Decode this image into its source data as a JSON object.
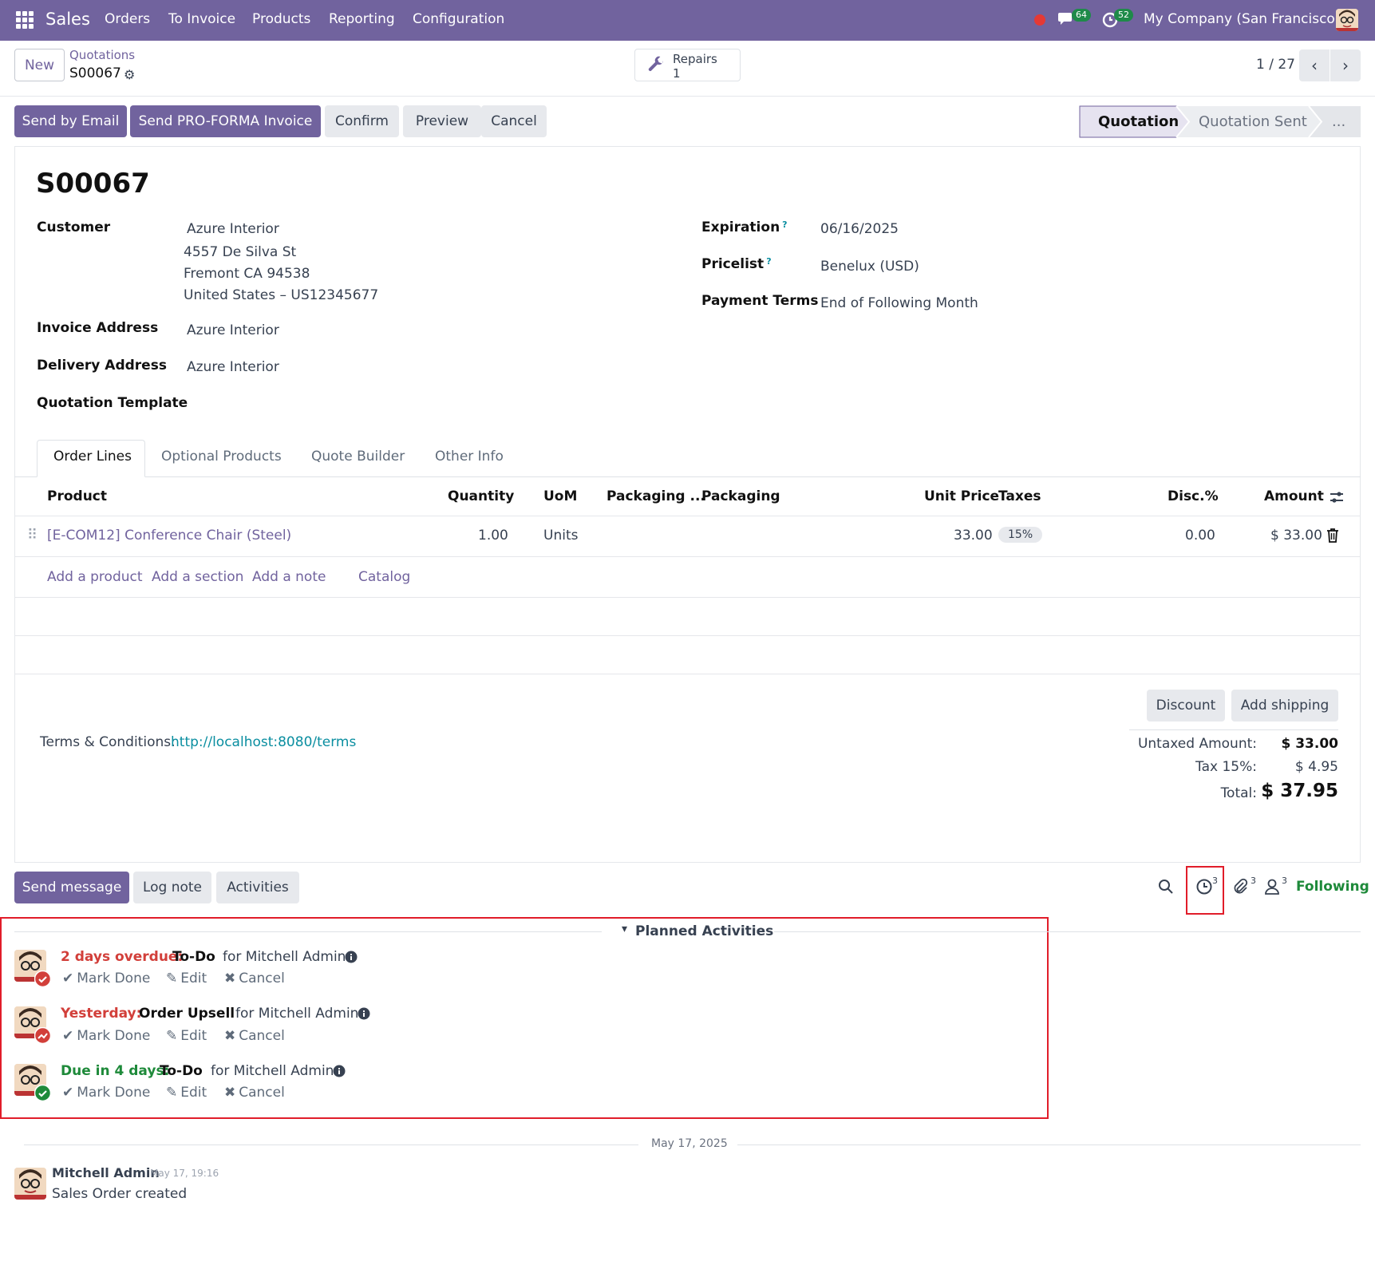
{
  "topbar": {
    "app_name": "Sales",
    "menus": [
      "Orders",
      "To Invoice",
      "Products",
      "Reporting",
      "Configuration"
    ],
    "messages_count": "64",
    "activities_count": "52",
    "company": "My Company (San Francisco)"
  },
  "control_panel": {
    "new_label": "New",
    "breadcrumb_parent": "Quotations",
    "breadcrumb_current": "S00067",
    "repairs_label": "Repairs",
    "repairs_count": "1",
    "pager": "1 / 27"
  },
  "actions": {
    "send_email": "Send by Email",
    "send_proforma": "Send PRO-FORMA Invoice",
    "confirm": "Confirm",
    "preview": "Preview",
    "cancel": "Cancel"
  },
  "statusbar": {
    "stages": [
      "Quotation",
      "Quotation Sent",
      "..."
    ],
    "active": "Quotation"
  },
  "form": {
    "title": "S00067",
    "customer_label": "Customer",
    "customer_name": "Azure Interior",
    "customer_address": [
      "4557 De Silva St",
      "Fremont CA 94538",
      "United States – US12345677"
    ],
    "invoice_address_label": "Invoice Address",
    "invoice_address": "Azure Interior",
    "delivery_address_label": "Delivery Address",
    "delivery_address": "Azure Interior",
    "quotation_template_label": "Quotation Template",
    "expiration_label": "Expiration",
    "expiration": "06/16/2025",
    "pricelist_label": "Pricelist",
    "pricelist": "Benelux (USD)",
    "payment_terms_label": "Payment Terms",
    "payment_terms": "End of Following Month",
    "help_mark": "?"
  },
  "tabs": [
    "Order Lines",
    "Optional Products",
    "Quote Builder",
    "Other Info"
  ],
  "order_lines": {
    "columns": [
      "Product",
      "Quantity",
      "UoM",
      "Packaging ...",
      "Packaging",
      "Unit Price",
      "Taxes",
      "Disc.%",
      "Amount"
    ],
    "rows": [
      {
        "product": "[E-COM12] Conference Chair (Steel)",
        "quantity": "1.00",
        "uom": "Units",
        "unit_price": "33.00",
        "taxes": "15%",
        "discount": "0.00",
        "amount": "$ 33.00"
      }
    ],
    "add_product": "Add a product",
    "add_section": "Add a section",
    "add_note": "Add a note",
    "catalog": "Catalog"
  },
  "footer": {
    "discount": "Discount",
    "add_shipping": "Add shipping",
    "terms_label": "Terms & Conditions:",
    "terms_link": "http://localhost:8080/terms",
    "untaxed_label": "Untaxed Amount:",
    "untaxed_value": "$ 33.00",
    "tax_label": "Tax 15%:",
    "tax_value": "$ 4.95",
    "total_label": "Total:",
    "total_value": "$ 37.95"
  },
  "chatter": {
    "send_message": "Send message",
    "log_note": "Log note",
    "activities": "Activities",
    "activities_count": "3",
    "attachments_count": "3",
    "followers_count": "3",
    "following": "Following",
    "planned_title": "Planned Activities",
    "mark_done": "Mark Done",
    "edit": "Edit",
    "cancel": "Cancel",
    "items": [
      {
        "when": "2 days overdue:",
        "type": "To-Do",
        "assignee": "for Mitchell Admin",
        "color": "#d23f3a"
      },
      {
        "when": "Yesterday:",
        "type": "Order Upsell",
        "assignee": "for Mitchell Admin",
        "color": "#d23f3a"
      },
      {
        "when": "Due in 4 days:",
        "type": "To-Do",
        "assignee": "for Mitchell Admin",
        "color": "#1e8a3a"
      }
    ],
    "date_separator": "May 17, 2025",
    "message_author": "Mitchell Admin",
    "message_time": "May 17, 19:16",
    "message_body": "Sales Order created"
  },
  "colors": {
    "brand": "#71639e",
    "overdue": "#d23f3a",
    "ok": "#1e8a3a",
    "link": "#0a8ea0",
    "highlight_box": "#e11d2a"
  }
}
